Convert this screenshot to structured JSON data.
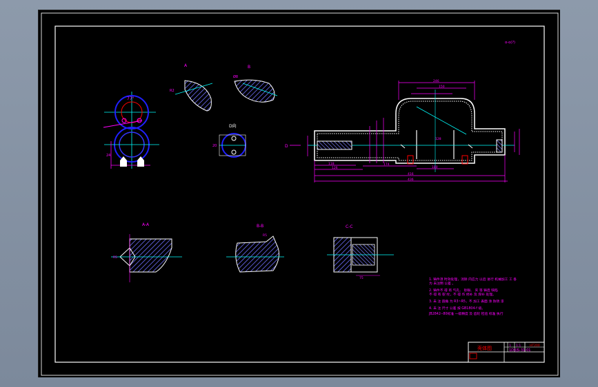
{
  "colors": {
    "background": "#000000",
    "frame": "#ffffff",
    "outline": "#ffffff",
    "dimension": "#ff00ff",
    "centerline": "#00ffff",
    "circle": "#0000ff",
    "hatch": "#6e6eff",
    "text_red": "#ff0000"
  },
  "drawing": {
    "corner_note": "α-α(?)",
    "views": {
      "a": "A",
      "b": "B",
      "d": "D向",
      "a_a": "A-A",
      "b_b": "B-B",
      "c_c": "C-C"
    },
    "main_view": {
      "dims": {
        "d1": "118",
        "d2": "126",
        "d3": "174",
        "d4": "180",
        "d5": "416",
        "d6": "436",
        "d7": "246",
        "d8": "150",
        "d9": "128"
      },
      "arrow_label": "D"
    },
    "notes": [
      "1.  铸件须 时效处理，消除 内应力 以后 进行 机械加工 工 各",
      "    为 未注明 公差 。",
      "2.  铸件不 得 有 气孔、 砂眼、 夹 等 铸造 缺陷",
      "    不 得 有 裂 纹，不 得 作 修补 及 焊补 处理。",
      "3.  未 注 圆角 为 R3~R5，不 加工 表面 涂 防锈 漆",
      "4.  未 注 尺寸 公差 按 GB1804-f 级。",
      "    JB2842--80标准 一级精度 及 齿轮 检验 标准 执行"
    ]
  },
  "title_block": {
    "name": "壳体图",
    "code": "1DXJS-31-01",
    "material": "HT200",
    "scale": "1:1",
    "sheet": "1"
  }
}
